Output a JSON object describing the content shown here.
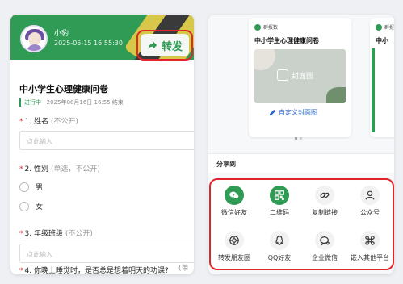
{
  "left_panel": {
    "user": {
      "name": "小豹",
      "time": "2025-05-15 16:55:30"
    },
    "forward_label": "转发",
    "form_title": "中小学生心理健康问卷",
    "status": {
      "state": "进行中",
      "text": " · 2025年08月16日 16:55 结束"
    },
    "questions": [
      {
        "num": "1.",
        "title": "姓名",
        "note": "(不公开)",
        "placeholder": "点此输入"
      },
      {
        "num": "2.",
        "title": "性别",
        "note": "(单选，不公开)",
        "options": [
          "男",
          "女"
        ]
      },
      {
        "num": "3.",
        "title": "年级班级",
        "note": "(不公开)",
        "placeholder": "点此输入"
      },
      {
        "num": "4.",
        "title": "你晚上睡觉时，是否总是想着明天的功课?",
        "note": "(单"
      }
    ],
    "overflow_hint": "(单"
  },
  "right_panel": {
    "card": {
      "app_name": "群报数",
      "title": "中小学生心理健康问卷",
      "cover_text": "封面图",
      "custom_cover": "自定义封面图"
    },
    "card2_app_name": "群报",
    "card2_title": "中小",
    "share_title": "分享到",
    "share_items": [
      {
        "label": "微信好友",
        "icon": "wechat-icon"
      },
      {
        "label": "二维码",
        "icon": "qrcode-icon"
      },
      {
        "label": "复制链接",
        "icon": "link-icon"
      },
      {
        "label": "公众号",
        "icon": "user-icon"
      },
      {
        "label": "转发朋友圈",
        "icon": "moments-icon"
      },
      {
        "label": "QQ好友",
        "icon": "qq-icon"
      },
      {
        "label": "企业微信",
        "icon": "wecom-icon"
      },
      {
        "label": "嵌入其他平台",
        "icon": "command-icon"
      }
    ]
  },
  "colors": {
    "brand_green": "#2f9b55",
    "highlight_red": "#e0262b",
    "link_blue": "#2b66c9"
  }
}
